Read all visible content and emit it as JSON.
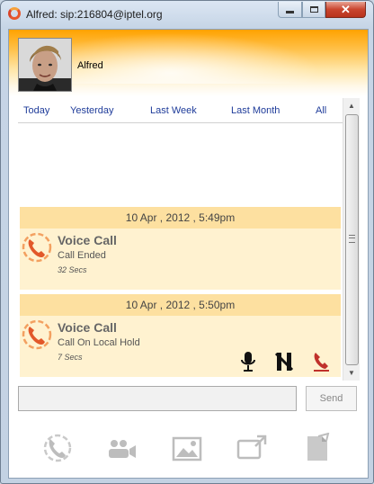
{
  "window": {
    "title": "Alfred: sip:216804@iptel.org"
  },
  "contact": {
    "name": "Alfred"
  },
  "filters": [
    "Today",
    "Yesterday",
    "Last Week",
    "Last Month",
    "All"
  ],
  "calls": [
    {
      "date": "10 Apr , 2012 , 5:49pm",
      "type": "Voice Call",
      "status": "Call Ended",
      "duration": "32 Secs",
      "controls": false
    },
    {
      "date": "10 Apr , 2012 , 5:50pm",
      "type": "Voice Call",
      "status": "Call On Local Hold",
      "duration": "7 Secs",
      "controls": true
    }
  ],
  "composer": {
    "placeholder": "",
    "send_label": "Send"
  },
  "toolbar": [
    "voice-call-icon",
    "video-call-icon",
    "send-image-icon",
    "screen-share-icon",
    "send-file-icon"
  ],
  "colors": {
    "accent": "#ff9a00",
    "call_card": "#fff2d0",
    "call_date_bar": "#fde0a0",
    "link": "#1f3c9a"
  }
}
